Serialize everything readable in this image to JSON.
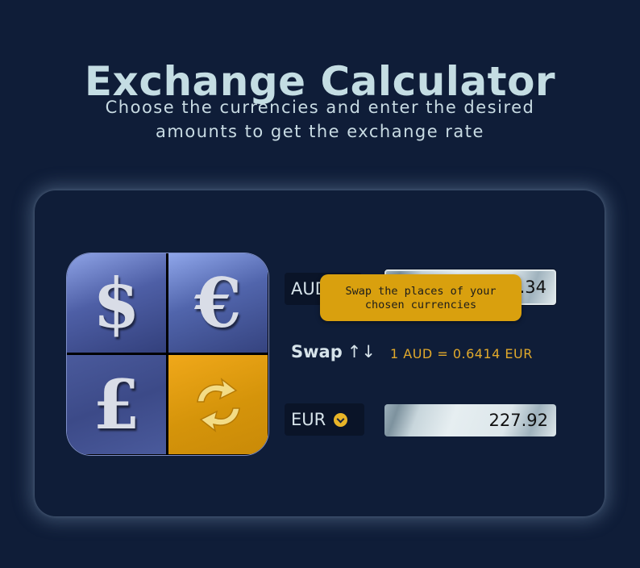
{
  "header": {
    "title": "Exchange Calculator",
    "subtitle_line1": "Choose the currencies and enter the desired",
    "subtitle_line2": "amounts to get the exchange rate"
  },
  "logo": {
    "tiles": [
      {
        "symbol": "$",
        "icon": "dollar-icon"
      },
      {
        "symbol": "€",
        "icon": "euro-icon"
      },
      {
        "symbol": "£",
        "icon": "pound-icon"
      },
      {
        "symbol": "",
        "icon": "swap-arrows-icon"
      }
    ]
  },
  "from": {
    "currency": "AUD",
    "amount": "355.34"
  },
  "to": {
    "currency": "EUR",
    "amount": "227.92"
  },
  "swap": {
    "label": "Swap",
    "arrows": "↑↓"
  },
  "rate_text": "1 AUD = 0.6414 EUR",
  "tooltip": {
    "line1": "Swap the places of your",
    "line2": "chosen currencies"
  },
  "colors": {
    "background": "#0f1d38",
    "accent": "#e1a92b",
    "tooltip_bg": "#d9a00e"
  }
}
